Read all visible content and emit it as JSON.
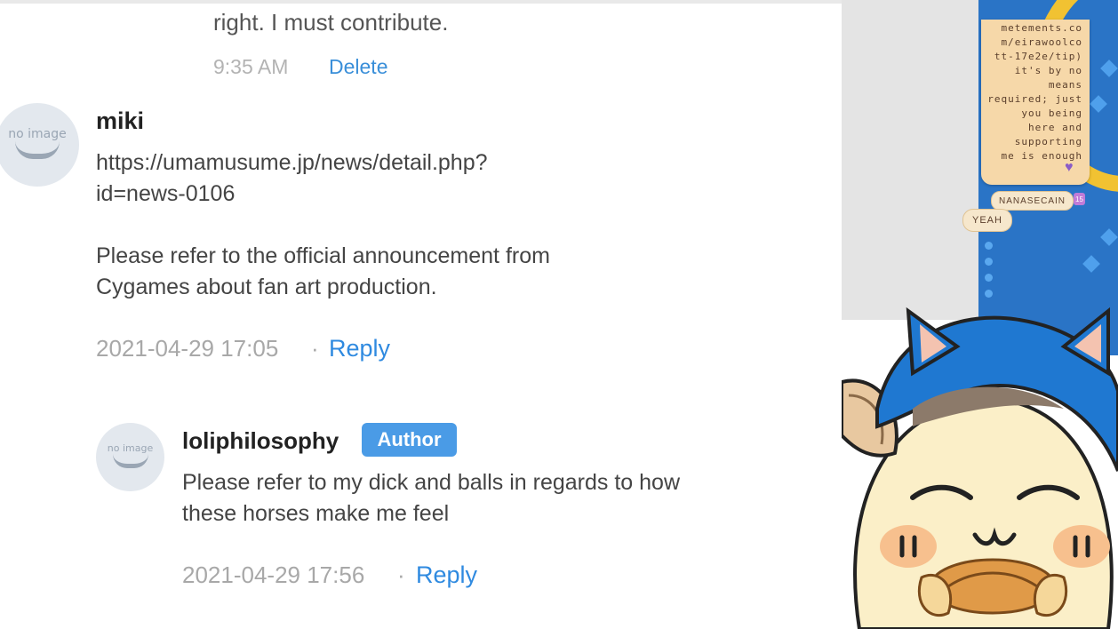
{
  "previous_comment": {
    "tail_text": "right. I must contribute.",
    "time": "9:35 AM",
    "delete_label": "Delete"
  },
  "comment": {
    "avatar_text": "no image",
    "author": "miki",
    "body_line1": "https://umamusume.jp/news/detail.php?",
    "body_line2": "id=news-0106",
    "body_line3": "Please refer to the official announcement from",
    "body_line4": "Cygames about fan art production.",
    "date": "2021-04-29 17:05",
    "separator": "·",
    "reply_label": "Reply"
  },
  "reply": {
    "avatar_text": "no image",
    "author": "loliphilosophy",
    "badge": "Author",
    "body_line1": "Please refer to my dick and balls in regards to how",
    "body_line2": "these horses make me feel",
    "date": "2021-04-29 17:56",
    "separator": "·",
    "reply_label": "Reply"
  },
  "stream_overlay": {
    "chat_message": "metements.co\nm/eirawoolco\ntt-17e2e/tip)\nit's by no\nmeans\nrequired; just\nyou being\nhere and\nsupporting\nme is enough",
    "chat_username": "NANASECAIN",
    "chat_badge": "15",
    "reaction_text": "YEAH",
    "colors": {
      "accent_blue": "#2a74c6",
      "bubble": "#f6d8a9",
      "link": "#2f8ae0",
      "author_badge": "#4a9be6"
    }
  }
}
